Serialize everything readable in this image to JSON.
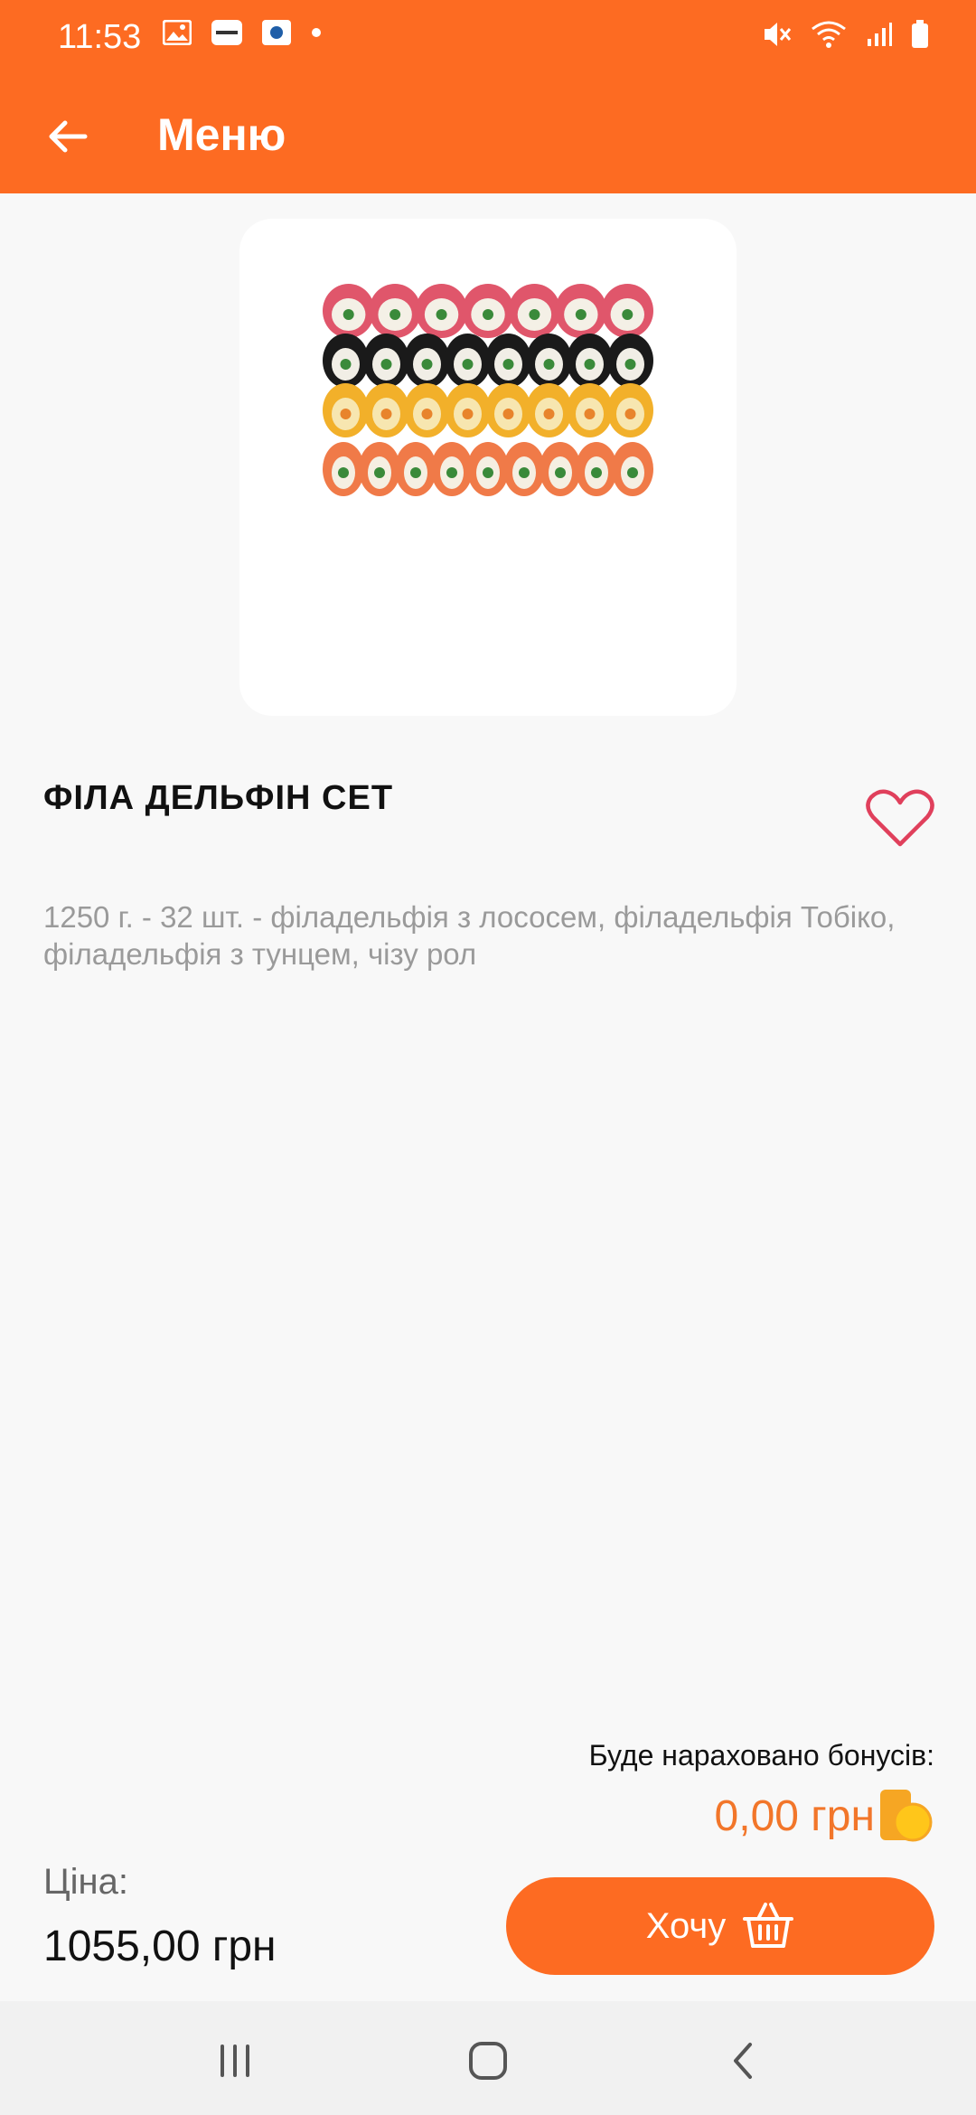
{
  "status_bar": {
    "time": "11:53",
    "left_icons": [
      "gallery-icon",
      "app-notification-icon",
      "app-notification-icon",
      "dot-icon"
    ],
    "right_icons": [
      "mute-icon",
      "wifi-icon",
      "signal-icon",
      "battery-icon"
    ]
  },
  "app_bar": {
    "title": "Меню",
    "back_icon": "arrow-left-icon",
    "background_color": "#fd6b22"
  },
  "product": {
    "name": "ФІЛА ДЕЛЬФІН СЕТ",
    "description": "1250 г. - 32 шт. - філадельфія з лососем, філадельфія Тобіко, філадельфія з тунцем, чізу рол",
    "favorite_icon": "heart-outline-icon"
  },
  "bonus": {
    "label": "Буде нараховано бонусів:",
    "value": "0,00 грн",
    "icon": "coin-icon"
  },
  "price": {
    "label": "Ціна:",
    "value": "1055,00 грн"
  },
  "cta": {
    "label": "Хочу",
    "icon": "basket-icon"
  },
  "nav_bar": {
    "items": [
      "recents-icon",
      "home-icon",
      "back-icon"
    ]
  },
  "colors": {
    "accent": "#fd6b22",
    "bonus_text": "#f2762a",
    "favorite": "#e0405c"
  }
}
